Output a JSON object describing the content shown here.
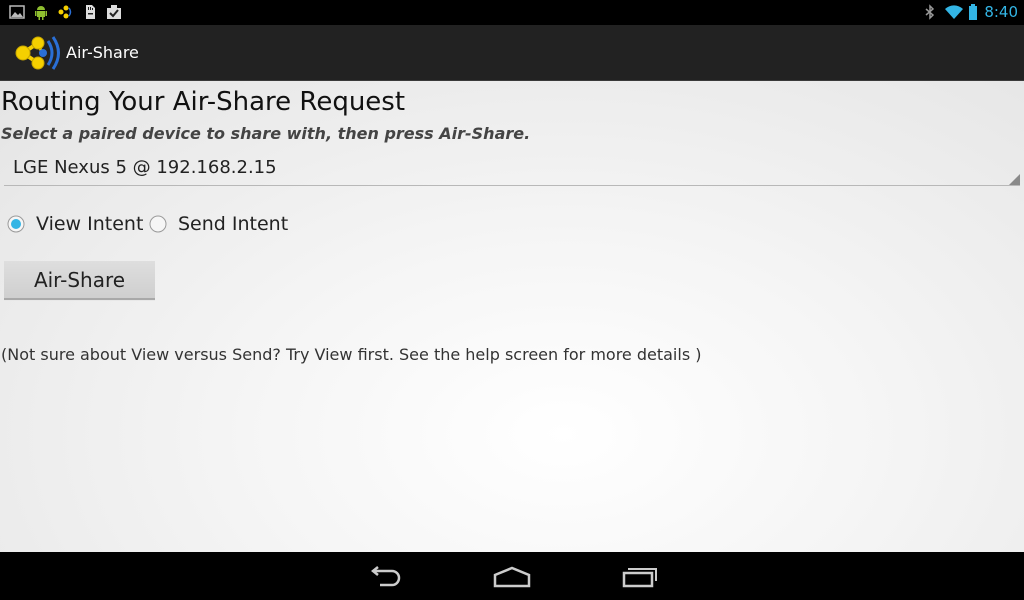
{
  "status_bar": {
    "clock": "8:40",
    "left_icons": [
      "image-notification-icon",
      "android-debug-icon",
      "airshare-notification-icon",
      "sd-card-icon",
      "download-complete-icon"
    ],
    "right_icons": [
      "bluetooth-icon",
      "wifi-icon",
      "battery-icon"
    ],
    "accent_color": "#33b5e5"
  },
  "action_bar": {
    "app_title": "Air-Share",
    "logo_colors": [
      "#f5d000",
      "#2a6fd6"
    ]
  },
  "main": {
    "heading": "Routing Your Air-Share Request",
    "instructions": "Select a paired device to share with, then press Air-Share.",
    "device_select": {
      "selected": "LGE Nexus 5 @ 192.168.2.15"
    },
    "intent_options": [
      {
        "label": "View Intent",
        "checked": true
      },
      {
        "label": "Send Intent",
        "checked": false
      }
    ],
    "share_button": "Air-Share",
    "help_text": "(Not sure about View versus Send? Try View first. See the help screen for more details )"
  },
  "nav_bar": {
    "buttons": [
      "back-icon",
      "home-icon",
      "recent-apps-icon"
    ]
  }
}
